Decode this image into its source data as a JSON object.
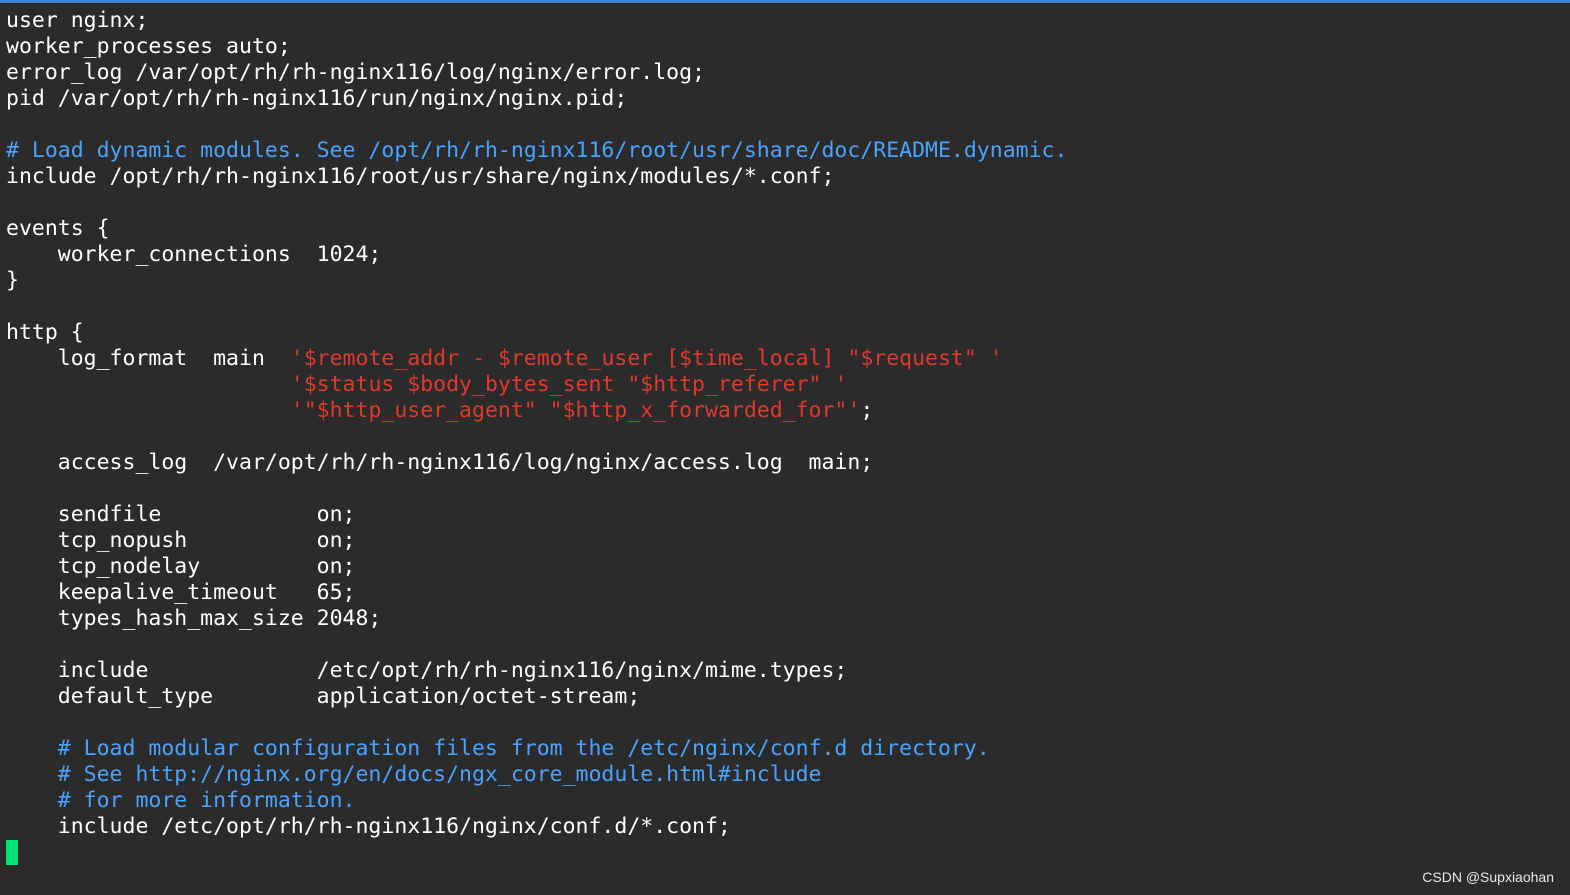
{
  "terminal": {
    "lines": [
      {
        "parts": [
          {
            "t": "user nginx;",
            "c": "normal"
          }
        ]
      },
      {
        "parts": [
          {
            "t": "worker_processes auto;",
            "c": "normal"
          }
        ]
      },
      {
        "parts": [
          {
            "t": "error_log /var/opt/rh/rh-nginx116/log/nginx/error.log;",
            "c": "normal"
          }
        ]
      },
      {
        "parts": [
          {
            "t": "pid /var/opt/rh/rh-nginx116/run/nginx/nginx.pid;",
            "c": "normal"
          }
        ]
      },
      {
        "parts": []
      },
      {
        "parts": [
          {
            "t": "# Load dynamic modules. See /opt/rh/rh-nginx116/root/usr/share/doc/README.dynamic.",
            "c": "comment"
          }
        ]
      },
      {
        "parts": [
          {
            "t": "include /opt/rh/rh-nginx116/root/usr/share/nginx/modules/*.conf;",
            "c": "normal"
          }
        ]
      },
      {
        "parts": []
      },
      {
        "parts": [
          {
            "t": "events {",
            "c": "normal"
          }
        ]
      },
      {
        "parts": [
          {
            "t": "    worker_connections  1024;",
            "c": "normal"
          }
        ]
      },
      {
        "parts": [
          {
            "t": "}",
            "c": "normal"
          }
        ]
      },
      {
        "parts": []
      },
      {
        "parts": [
          {
            "t": "http {",
            "c": "normal"
          }
        ]
      },
      {
        "parts": [
          {
            "t": "    log_format  main  ",
            "c": "normal"
          },
          {
            "t": "'$remote_addr - $remote_user [$time_local] \"$request\" '",
            "c": "str"
          }
        ]
      },
      {
        "parts": [
          {
            "t": "                      ",
            "c": "normal"
          },
          {
            "t": "'$status $body_bytes_sent \"$http_referer\" '",
            "c": "str"
          }
        ]
      },
      {
        "parts": [
          {
            "t": "                      ",
            "c": "normal"
          },
          {
            "t": "'\"$http_user_agent\" \"$http_x_forwarded_for\"'",
            "c": "str"
          },
          {
            "t": ";",
            "c": "normal"
          }
        ]
      },
      {
        "parts": []
      },
      {
        "parts": [
          {
            "t": "    access_log  /var/opt/rh/rh-nginx116/log/nginx/access.log  main;",
            "c": "normal"
          }
        ]
      },
      {
        "parts": []
      },
      {
        "parts": [
          {
            "t": "    sendfile            on;",
            "c": "normal"
          }
        ]
      },
      {
        "parts": [
          {
            "t": "    tcp_nopush          on;",
            "c": "normal"
          }
        ]
      },
      {
        "parts": [
          {
            "t": "    tcp_nodelay         on;",
            "c": "normal"
          }
        ]
      },
      {
        "parts": [
          {
            "t": "    keepalive_timeout   65;",
            "c": "normal"
          }
        ]
      },
      {
        "parts": [
          {
            "t": "    types_hash_max_size 2048;",
            "c": "normal"
          }
        ]
      },
      {
        "parts": []
      },
      {
        "parts": [
          {
            "t": "    include             /etc/opt/rh/rh-nginx116/nginx/mime.types;",
            "c": "normal"
          }
        ]
      },
      {
        "parts": [
          {
            "t": "    default_type        application/octet-stream;",
            "c": "normal"
          }
        ]
      },
      {
        "parts": []
      },
      {
        "parts": [
          {
            "t": "    # Load modular configuration files from the /etc/nginx/conf.d directory.",
            "c": "comment"
          }
        ]
      },
      {
        "parts": [
          {
            "t": "    # See http://nginx.org/en/docs/ngx_core_module.html#include",
            "c": "comment"
          }
        ]
      },
      {
        "parts": [
          {
            "t": "    # for more information.",
            "c": "comment"
          }
        ]
      },
      {
        "parts": [
          {
            "t": "    include /etc/opt/rh/rh-nginx116/nginx/conf.d/*.conf;",
            "c": "normal"
          }
        ]
      },
      {
        "parts": [],
        "cursor": true
      }
    ]
  },
  "watermark": "CSDN @Supxiaohan",
  "colors": {
    "background": "#2b2b2b",
    "text": "#ffffff",
    "comment": "#4aa3ff",
    "string": "#e03a2f",
    "cursor": "#00e676",
    "accent_bar": "#3d83d6"
  }
}
